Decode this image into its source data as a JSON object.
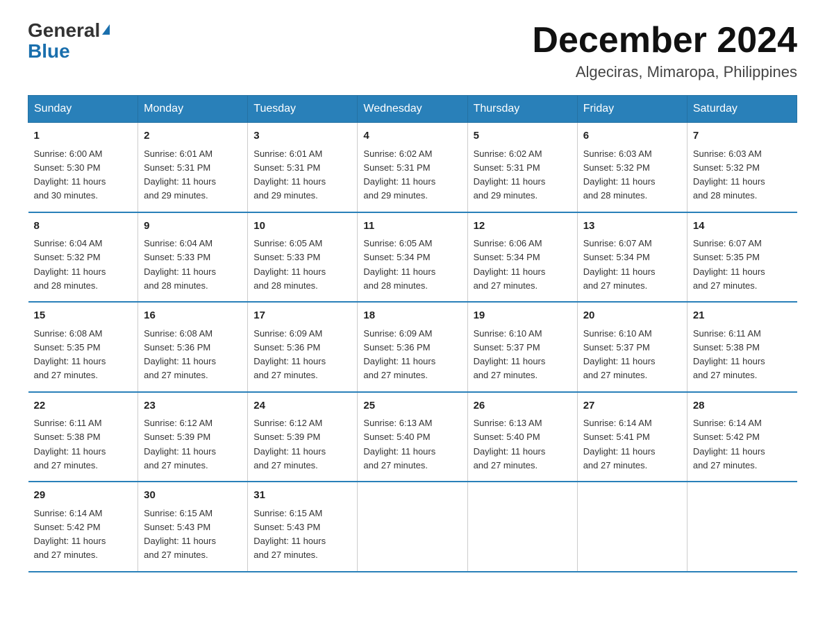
{
  "header": {
    "logo_general": "General",
    "logo_blue": "Blue",
    "month_title": "December 2024",
    "location": "Algeciras, Mimaropa, Philippines"
  },
  "days_of_week": [
    "Sunday",
    "Monday",
    "Tuesday",
    "Wednesday",
    "Thursday",
    "Friday",
    "Saturday"
  ],
  "weeks": [
    [
      {
        "day": "1",
        "sunrise": "6:00 AM",
        "sunset": "5:30 PM",
        "daylight": "11 hours and 30 minutes."
      },
      {
        "day": "2",
        "sunrise": "6:01 AM",
        "sunset": "5:31 PM",
        "daylight": "11 hours and 29 minutes."
      },
      {
        "day": "3",
        "sunrise": "6:01 AM",
        "sunset": "5:31 PM",
        "daylight": "11 hours and 29 minutes."
      },
      {
        "day": "4",
        "sunrise": "6:02 AM",
        "sunset": "5:31 PM",
        "daylight": "11 hours and 29 minutes."
      },
      {
        "day": "5",
        "sunrise": "6:02 AM",
        "sunset": "5:31 PM",
        "daylight": "11 hours and 29 minutes."
      },
      {
        "day": "6",
        "sunrise": "6:03 AM",
        "sunset": "5:32 PM",
        "daylight": "11 hours and 28 minutes."
      },
      {
        "day": "7",
        "sunrise": "6:03 AM",
        "sunset": "5:32 PM",
        "daylight": "11 hours and 28 minutes."
      }
    ],
    [
      {
        "day": "8",
        "sunrise": "6:04 AM",
        "sunset": "5:32 PM",
        "daylight": "11 hours and 28 minutes."
      },
      {
        "day": "9",
        "sunrise": "6:04 AM",
        "sunset": "5:33 PM",
        "daylight": "11 hours and 28 minutes."
      },
      {
        "day": "10",
        "sunrise": "6:05 AM",
        "sunset": "5:33 PM",
        "daylight": "11 hours and 28 minutes."
      },
      {
        "day": "11",
        "sunrise": "6:05 AM",
        "sunset": "5:34 PM",
        "daylight": "11 hours and 28 minutes."
      },
      {
        "day": "12",
        "sunrise": "6:06 AM",
        "sunset": "5:34 PM",
        "daylight": "11 hours and 27 minutes."
      },
      {
        "day": "13",
        "sunrise": "6:07 AM",
        "sunset": "5:34 PM",
        "daylight": "11 hours and 27 minutes."
      },
      {
        "day": "14",
        "sunrise": "6:07 AM",
        "sunset": "5:35 PM",
        "daylight": "11 hours and 27 minutes."
      }
    ],
    [
      {
        "day": "15",
        "sunrise": "6:08 AM",
        "sunset": "5:35 PM",
        "daylight": "11 hours and 27 minutes."
      },
      {
        "day": "16",
        "sunrise": "6:08 AM",
        "sunset": "5:36 PM",
        "daylight": "11 hours and 27 minutes."
      },
      {
        "day": "17",
        "sunrise": "6:09 AM",
        "sunset": "5:36 PM",
        "daylight": "11 hours and 27 minutes."
      },
      {
        "day": "18",
        "sunrise": "6:09 AM",
        "sunset": "5:36 PM",
        "daylight": "11 hours and 27 minutes."
      },
      {
        "day": "19",
        "sunrise": "6:10 AM",
        "sunset": "5:37 PM",
        "daylight": "11 hours and 27 minutes."
      },
      {
        "day": "20",
        "sunrise": "6:10 AM",
        "sunset": "5:37 PM",
        "daylight": "11 hours and 27 minutes."
      },
      {
        "day": "21",
        "sunrise": "6:11 AM",
        "sunset": "5:38 PM",
        "daylight": "11 hours and 27 minutes."
      }
    ],
    [
      {
        "day": "22",
        "sunrise": "6:11 AM",
        "sunset": "5:38 PM",
        "daylight": "11 hours and 27 minutes."
      },
      {
        "day": "23",
        "sunrise": "6:12 AM",
        "sunset": "5:39 PM",
        "daylight": "11 hours and 27 minutes."
      },
      {
        "day": "24",
        "sunrise": "6:12 AM",
        "sunset": "5:39 PM",
        "daylight": "11 hours and 27 minutes."
      },
      {
        "day": "25",
        "sunrise": "6:13 AM",
        "sunset": "5:40 PM",
        "daylight": "11 hours and 27 minutes."
      },
      {
        "day": "26",
        "sunrise": "6:13 AM",
        "sunset": "5:40 PM",
        "daylight": "11 hours and 27 minutes."
      },
      {
        "day": "27",
        "sunrise": "6:14 AM",
        "sunset": "5:41 PM",
        "daylight": "11 hours and 27 minutes."
      },
      {
        "day": "28",
        "sunrise": "6:14 AM",
        "sunset": "5:42 PM",
        "daylight": "11 hours and 27 minutes."
      }
    ],
    [
      {
        "day": "29",
        "sunrise": "6:14 AM",
        "sunset": "5:42 PM",
        "daylight": "11 hours and 27 minutes."
      },
      {
        "day": "30",
        "sunrise": "6:15 AM",
        "sunset": "5:43 PM",
        "daylight": "11 hours and 27 minutes."
      },
      {
        "day": "31",
        "sunrise": "6:15 AM",
        "sunset": "5:43 PM",
        "daylight": "11 hours and 27 minutes."
      },
      null,
      null,
      null,
      null
    ]
  ],
  "labels": {
    "sunrise": "Sunrise:",
    "sunset": "Sunset:",
    "daylight": "Daylight:"
  }
}
